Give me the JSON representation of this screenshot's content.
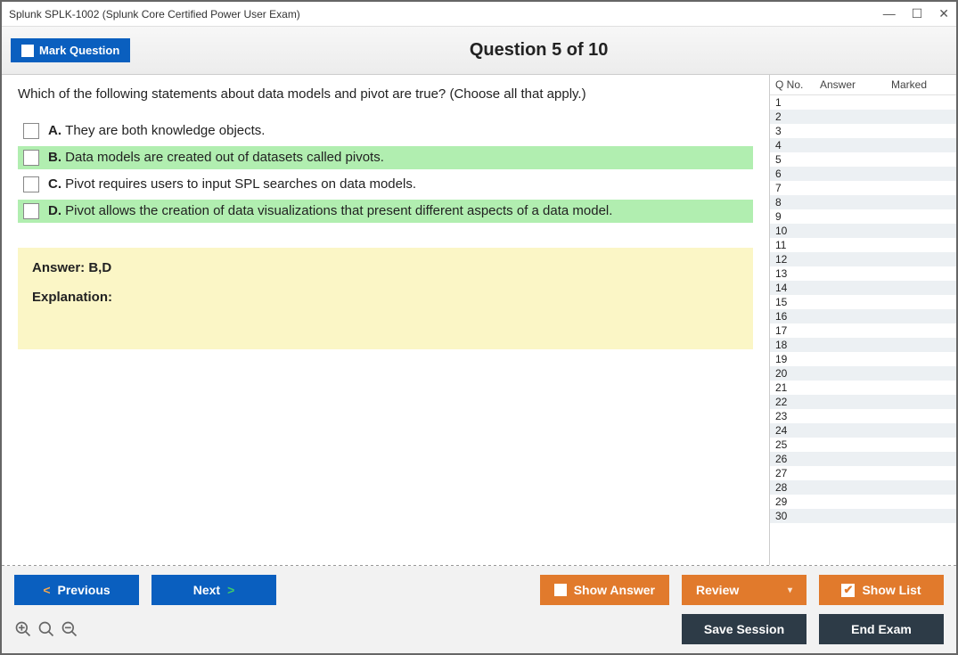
{
  "window": {
    "title": "Splunk SPLK-1002 (Splunk Core Certified Power User Exam)"
  },
  "header": {
    "mark_button": "Mark Question",
    "counter": "Question 5 of 10"
  },
  "question": {
    "text": "Which of the following statements about data models and pivot are true? (Choose all that apply.)",
    "options": [
      {
        "letter": "A.",
        "text": "They are both knowledge objects.",
        "highlight": false
      },
      {
        "letter": "B.",
        "text": "Data models are created out of datasets called pivots.",
        "highlight": true
      },
      {
        "letter": "C.",
        "text": "Pivot requires users to input SPL searches on data models.",
        "highlight": false
      },
      {
        "letter": "D.",
        "text": "Pivot allows the creation of data visualizations that present different aspects of a data model.",
        "highlight": true
      }
    ]
  },
  "answer": {
    "text": "Answer: B,D",
    "explanation_label": "Explanation:"
  },
  "grid": {
    "headers": {
      "qno": "Q No.",
      "answer": "Answer",
      "marked": "Marked"
    },
    "rows": 30
  },
  "footer": {
    "previous": "Previous",
    "next": "Next",
    "show_answer": "Show Answer",
    "review": "Review",
    "show_list": "Show List",
    "save_session": "Save Session",
    "end_exam": "End Exam"
  }
}
